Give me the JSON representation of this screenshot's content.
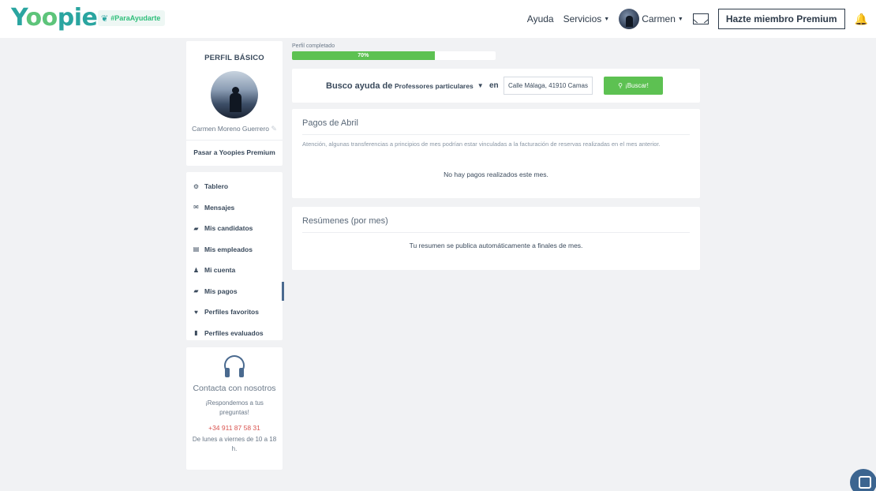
{
  "header": {
    "brand": {
      "prefix": "Y",
      "oo": "oo",
      "suffix": "pies"
    },
    "hashtag": "#ParaAyudarte",
    "nav": {
      "help": "Ayuda",
      "services": "Servicios",
      "user": "Carmen"
    },
    "premium_button": "Hazte miembro Premium",
    "bell_glyph": "🔔"
  },
  "profile": {
    "title": "PERFIL BÁSICO",
    "name": "Carmen Moreno Guerrero",
    "premium_link": "Pasar a Yoopies Premium"
  },
  "menu": {
    "items": [
      {
        "label": "Tablero",
        "icon": "⚙"
      },
      {
        "label": "Mensajes",
        "icon": "✉"
      },
      {
        "label": "Mis candidatos",
        "icon": "▰"
      },
      {
        "label": "Mis empleados",
        "icon": "▤"
      },
      {
        "label": "Mi cuenta",
        "icon": "♟"
      },
      {
        "label": "Mis pagos",
        "icon": "▰"
      },
      {
        "label": "Perfiles favoritos",
        "icon": "♥"
      },
      {
        "label": "Perfiles evaluados",
        "icon": "▮"
      }
    ],
    "active_index": 5
  },
  "contact": {
    "title": "Contacta con nosotros",
    "subtitle": "¡Respondemos a tus preguntas!",
    "phone": "+34 911 87 58 31",
    "hours": "De lunes a viernes de 10 a 18 h."
  },
  "progress": {
    "label": "Perfil completado",
    "value_text": "70%",
    "fraction": 0.7
  },
  "search": {
    "label": "Busco ayuda de",
    "category": "Professores particulares",
    "connector": "en",
    "location_value": "Calle Málaga, 41910 Camas",
    "button": "¡Buscar!"
  },
  "payments": {
    "title": "Pagos de Abril",
    "note": "Atención, algunas transferencias a principios de mes podrían estar vinculadas a la facturación de reservas realizadas en el mes anterior.",
    "empty": "No hay pagos realizados este mes."
  },
  "summaries": {
    "title": "Resúmenes (por mes)",
    "empty": "Tu resumen se publica automáticamente a finales de mes."
  },
  "colors": {
    "brand_teal": "#2aa5a0",
    "brand_green": "#5dc152",
    "accent_navy": "#4a6a8f",
    "phone_red": "#d9534f"
  }
}
